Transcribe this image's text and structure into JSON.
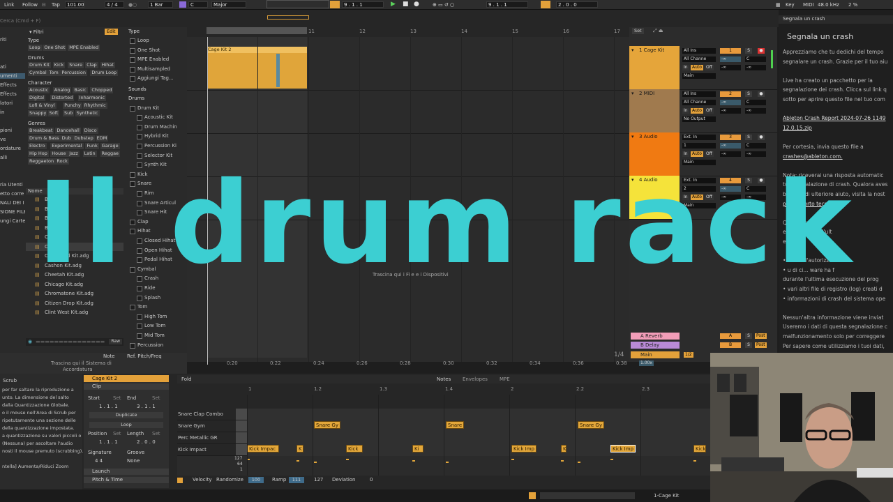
{
  "topbar": {
    "link": "Link",
    "follow": "Follow",
    "tap": "Tap",
    "tempo": "101.00",
    "signature": "4 / 4",
    "bar_quant": "1 Bar",
    "key": "C",
    "scale": "Major",
    "position": "9 .  1 .  1",
    "loop_start": "9 .  1 .  1",
    "loop_len": "2 .  0 .  0",
    "key_label": "Key",
    "midi_label": "MIDI",
    "samplerate": "48.0 kHz",
    "cpu": "2 %"
  },
  "browser": {
    "search_placeholder": "Cerca (Cmd + F)",
    "filters_title": "Filtri",
    "edit_label": "Edit",
    "type_title": "Type",
    "type_tags": [
      "Loop",
      "One Shot",
      "MPE Enabled"
    ],
    "drums_title": "Drums",
    "drums_tags": [
      "Drum Kit",
      "Kick",
      "Snare",
      "Clap",
      "Hihat",
      "Cymbal",
      "Tom",
      "Percussion",
      "Drum Loop"
    ],
    "character_title": "Character",
    "character_tags": [
      "Acoustic",
      "Analog",
      "Basic",
      "Chopped",
      "Digital",
      "Distorted",
      "Inharmonic",
      "Lofi & Vinyl",
      "Punchy",
      "Rhythmic",
      "Snappy",
      "Soft",
      "Sub",
      "Synthetic"
    ],
    "genres_title": "Genres",
    "genres_tags": [
      "Breakbeat",
      "Dancehall",
      "Disco",
      "Drum & Bass",
      "Dub",
      "Dubstep",
      "EDM",
      "Electro",
      "Experimental",
      "Funk",
      "Garage",
      "Hip Hop",
      "House",
      "Jazz",
      "Latin",
      "Reggae",
      "Reggaeton",
      "Rock"
    ],
    "sidebar_items": [
      "riti",
      "",
      "",
      "ati",
      "umenti",
      "Effects",
      "Effects",
      "latori",
      "in",
      "",
      "pioni",
      "ve",
      "ordature",
      "alli",
      "",
      "",
      "ria Utenti",
      "etto corre",
      "NALI DEI I",
      "SIONE FILE",
      "ungi Carte"
    ],
    "col_type_title": "Type",
    "col_type_items": [
      "Loop",
      "One Shot",
      "MPE Enabled",
      "Multisampled",
      "Aggiungi Tag..."
    ],
    "col_sounds": "Sounds",
    "col_drums": "Drums",
    "col_drums_items": [
      "Drum Kit",
      "Acoustic Kit",
      "Drum Machin",
      "Hybrid Kit",
      "Percussion Ki",
      "Selector Kit",
      "Synth Kit",
      "Kick",
      "Snare",
      "Rim",
      "Snare Articul",
      "Snare Hit",
      "Clap",
      "Hihat",
      "Closed Hihat",
      "Open Hihat",
      "Pedal Hihat",
      "Cymbal",
      "Crash",
      "Ride",
      "Splash",
      "Tom",
      "High Tom",
      "Low Tom",
      "Mid Tom",
      "Percussion"
    ],
    "file_header": "Nome",
    "files": [
      "Bl...adg",
      "B...adg",
      "B...adg",
      "B...d.adg",
      "C...adg",
      "C...adg",
      "Cardboard Kit.adg",
      "Cashon Kit.adg",
      "Cheetah Kit.adg",
      "Chicago Kit.adg",
      "Chromatone Kit.adg",
      "Citizen Drop Kit.adg",
      "Clint West Kit.adg"
    ],
    "raw_label": "Raw",
    "status_text": "Trascina qui il Sistema di",
    "status_text2": "Accordatura",
    "note_col": "Note",
    "refpitch_col": "Ref. Pitch/Freq"
  },
  "arrangement": {
    "ruler": [
      "9",
      "10",
      "11",
      "12",
      "13",
      "14",
      "15",
      "16",
      "17"
    ],
    "clip_name": "Cage Kit 2",
    "drop_text": "Trascina qui i File e i Dispositivi",
    "times": [
      "0:20",
      "0:22",
      "0:24",
      "0:26",
      "0:28",
      "0:30",
      "0:32",
      "0:34",
      "0:36",
      "0:38"
    ],
    "zoom": "1/4",
    "set_label": "Set"
  },
  "mixer": {
    "tracks": [
      {
        "name": "1 Cage Kit",
        "color": "#e5a53a",
        "input": "All Ins",
        "channel": "All Channe",
        "num": "1",
        "out": "Main"
      },
      {
        "name": "2 MIDI",
        "color": "#a07a4e",
        "input": "All Ins",
        "channel": "All Channe",
        "num": "2",
        "out": "No Output"
      },
      {
        "name": "3 Audio",
        "color": "#f07a12",
        "input": "Ext. In",
        "channel": "1",
        "num": "3",
        "out": "Main"
      },
      {
        "name": "4 Audio",
        "color": "#f5e33a",
        "input": "Ext. In",
        "channel": "2",
        "num": "4",
        "out": "Main"
      }
    ],
    "returns": [
      {
        "name": "A Reverb",
        "color": "#f29db8",
        "letter": "A"
      },
      {
        "name": "B Delay",
        "color": "#b98ad6",
        "letter": "B"
      }
    ],
    "main": "Main",
    "main_zoom": "1.00x",
    "main_frac": "1/2",
    "auto": "Auto",
    "off": "Off",
    "in": "In",
    "post": "Post",
    "inf": "-∞"
  },
  "crash_panel": {
    "header": "Segnala un crash",
    "title": "Segnala un crash",
    "lines": [
      "Apprezziamo che tu dedichi del tempo",
      "segnalare un crash. Grazie per il tuo aiu",
      "",
      "Live ha creato un pacchetto per la",
      "segnalazione dei crash. Clicca sul link q",
      "sotto per aprire questo file nel tuo com",
      "",
      "Ableton Crash Report 2024-07-26 1149",
      "12.0.15.zip",
      "",
      "Per cortesia, invia questo file a",
      "crashes@ableton.com.",
      "",
      "Nota: riceverai una risposta automatic",
      "tua segnalazione di crash. Qualora aves",
      "bisogno di ulteriore aiuto, visita la nost",
      "pagi... porto tecnico.",
      "",
      "Que...                    zione di cr",
      "es...                  nerate dall'ult",
      "ese...",
      "",
      "• i          ...            dell'autorizza",
      "• u     di ci...              ware ha f",
      "  durante l'ultima esecuzione del prog",
      "• vari altri file di registro (log) creati d",
      "• informazioni di crash del sistema ope",
      "",
      "Nessun'altra informazione viene inviat",
      "Useremo i dati di questa segnalazione c",
      "malfunzionamento solo per correggere",
      "Per sapere come utilizziamo i tuoi dati,",
      "nostra politica sulla privacy."
    ]
  },
  "clip_panel": {
    "scrub_title": "Scrub",
    "help_lines": [
      "per far saltare la riproduzione a",
      "unto. La dimensione del salto",
      "dalla Quantizzazione Globale.",
      "o il mouse nell'Area di Scrub per",
      "ripetutamente una sezione delle",
      "della quantizzazione impostata.",
      "a quantizzazione su valori piccoli o",
      "(Nessuna) per ascoltare l'audio",
      "nosti il mouse premuto (scrubbing).",
      "",
      "ntella] Aumenta/Riduci Zoom"
    ],
    "clip_name": "Cage Kit 2",
    "clip_label": "Clip",
    "start": "Start",
    "set": "Set",
    "end": "End",
    "start_val": "1 .  1 .  1",
    "end_val": "3 .  1 .  1",
    "duplicate": "Duplicate",
    "loop": "Loop",
    "position": "Position",
    "length": "Length",
    "pos_val": "1 .  1 .  1",
    "len_val": "2 .  0 .  0",
    "signature": "Signature",
    "groove": "Groove",
    "sig_val": "4     4",
    "groove_val": "None",
    "launch": "Launch",
    "pitch_time": "Pitch & Time",
    "fold": "Fold",
    "tabs": [
      "Notes",
      "Envelopes",
      "MPE"
    ],
    "ruler": [
      "1",
      "1.2",
      "1.3",
      "1.4",
      "2",
      "2.2",
      "2.3"
    ],
    "lanes": [
      "Snare Clap Combo",
      "Snare Gym",
      "Perc Metallic GR",
      "Kick Impact"
    ],
    "vel_scale": [
      "127",
      "64",
      "1"
    ],
    "velocity": "Velocity",
    "randomize": "Randomize",
    "rand_val": "100",
    "ramp": "Ramp",
    "ramp_val": "111",
    "ramp_val2": "127",
    "deviation": "Deviation",
    "dev_val": "0",
    "snare_notes": [
      "Snare Gy",
      "Snare",
      "Snare Gy"
    ],
    "kick_notes": [
      "Kick Impac",
      "K",
      "Kick",
      "Ki",
      "Kick Imp",
      "K",
      "Kick Imp",
      "Kick"
    ]
  },
  "footer": {
    "track_label": "1-Cage Kit"
  },
  "overlay_title": "Il drum rack"
}
